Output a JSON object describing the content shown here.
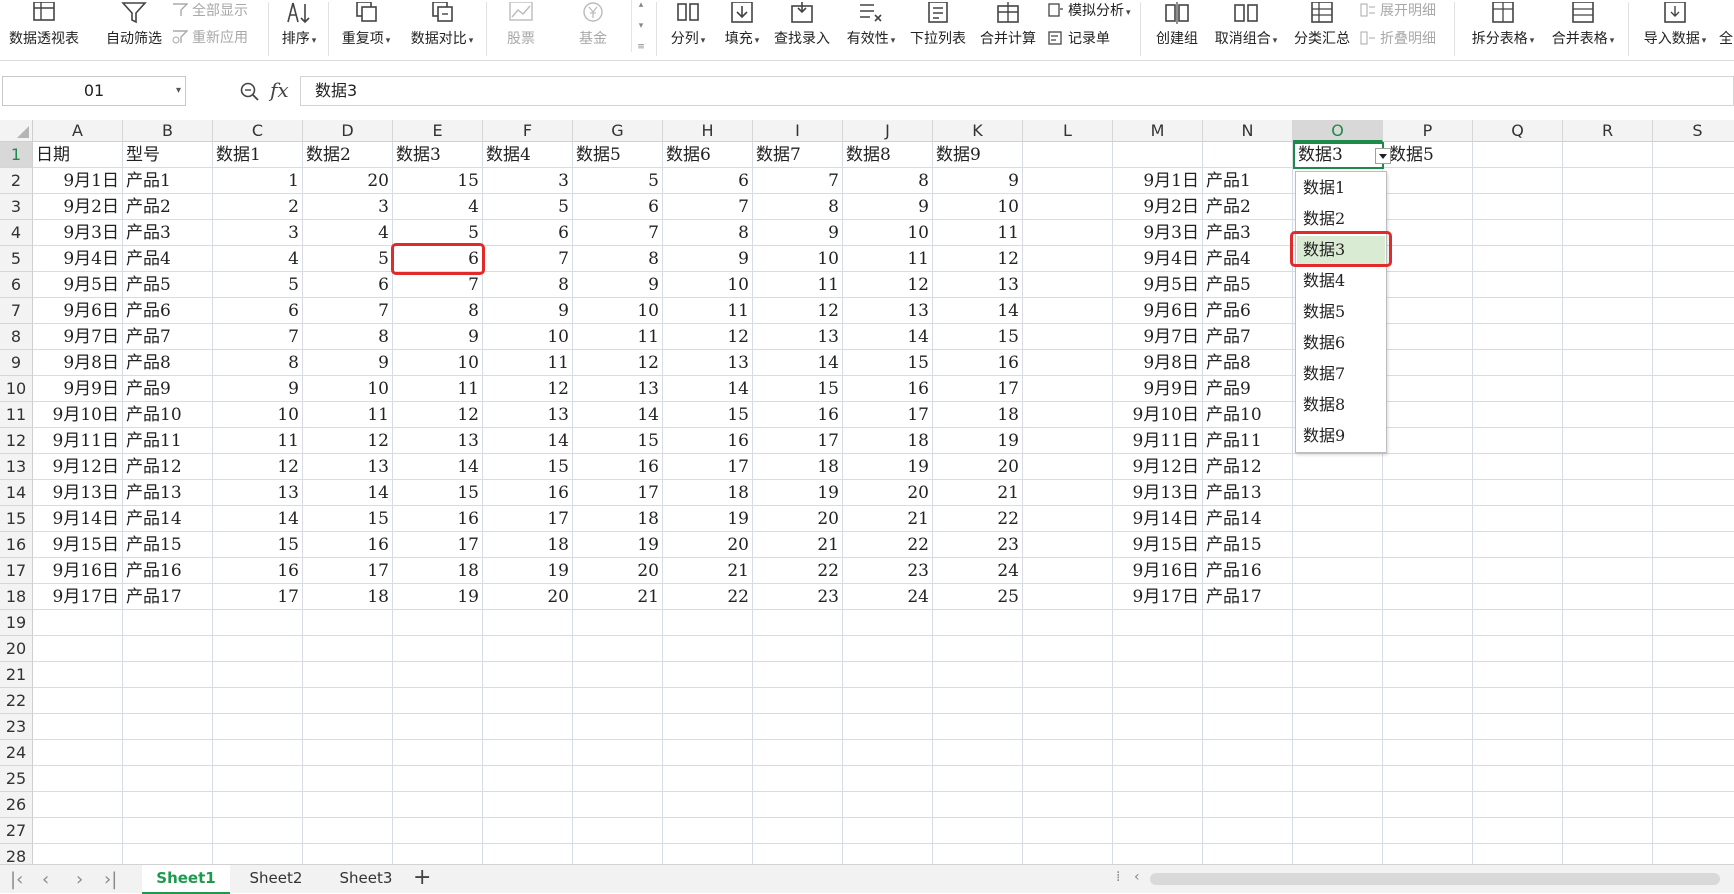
{
  "ribbon": {
    "pivot": "数据透视表",
    "autofilter": "自动筛选",
    "show_all": "全部显示",
    "reapply": "重新应用",
    "sort": "排序",
    "duplicates": "重复项",
    "compare": "数据对比",
    "stock": "股票",
    "fund": "基金",
    "split": "分列",
    "fill": "填充",
    "lookup": "查找录入",
    "validity": "有效性",
    "dropdown_list": "下拉列表",
    "consolidate": "合并计算",
    "what_if": "模拟分析",
    "record_sheet": "记录单",
    "create_group": "创建组",
    "ungroup": "取消组合",
    "subtotal": "分类汇总",
    "expand_detail": "展开明细",
    "collapse_detail": "折叠明细",
    "split_table": "拆分表格",
    "merge_table": "合并表格",
    "import_data": "导入数据",
    "more": "全"
  },
  "formula_bar": {
    "name_box": "01",
    "fx": "fx",
    "content": "数据3"
  },
  "grid": {
    "columns": [
      "A",
      "B",
      "C",
      "D",
      "E",
      "F",
      "G",
      "H",
      "I",
      "J",
      "K",
      "L",
      "M",
      "N",
      "O",
      "P",
      "Q",
      "R",
      "S"
    ],
    "selected_column": "O",
    "rows": [
      "1",
      "2",
      "3",
      "4",
      "5",
      "6",
      "7",
      "8",
      "9",
      "10",
      "11",
      "12",
      "13",
      "14",
      "15",
      "16",
      "17",
      "18",
      "19",
      "20",
      "21",
      "22",
      "23",
      "24",
      "25",
      "26",
      "27",
      "28"
    ],
    "selected_row": "1",
    "header": [
      "日期",
      "型号",
      "数据1",
      "数据2",
      "数据3",
      "数据4",
      "数据5",
      "数据6",
      "数据7",
      "数据8",
      "数据9"
    ],
    "dates": [
      "9月1日",
      "9月2日",
      "9月3日",
      "9月4日",
      "9月5日",
      "9月6日",
      "9月7日",
      "9月8日",
      "9月9日",
      "9月10日",
      "9月11日",
      "9月12日",
      "9月13日",
      "9月14日",
      "9月15日",
      "9月16日",
      "9月17日"
    ],
    "products": [
      "产品1",
      "产品2",
      "产品3",
      "产品4",
      "产品5",
      "产品6",
      "产品7",
      "产品8",
      "产品9",
      "产品10",
      "产品11",
      "产品12",
      "产品13",
      "产品14",
      "产品15",
      "产品16",
      "产品17"
    ],
    "table": [
      [
        1,
        20,
        15,
        3,
        5,
        6,
        7,
        8,
        9
      ],
      [
        2,
        3,
        4,
        5,
        6,
        7,
        8,
        9,
        10
      ],
      [
        3,
        4,
        5,
        6,
        7,
        8,
        9,
        10,
        11
      ],
      [
        4,
        5,
        6,
        7,
        8,
        9,
        10,
        11,
        12
      ],
      [
        5,
        6,
        7,
        8,
        9,
        10,
        11,
        12,
        13
      ],
      [
        6,
        7,
        8,
        9,
        10,
        11,
        12,
        13,
        14
      ],
      [
        7,
        8,
        9,
        10,
        11,
        12,
        13,
        14,
        15
      ],
      [
        8,
        9,
        10,
        11,
        12,
        13,
        14,
        15,
        16
      ],
      [
        9,
        10,
        11,
        12,
        13,
        14,
        15,
        16,
        17
      ],
      [
        10,
        11,
        12,
        13,
        14,
        15,
        16,
        17,
        18
      ],
      [
        11,
        12,
        13,
        14,
        15,
        16,
        17,
        18,
        19
      ],
      [
        12,
        13,
        14,
        15,
        16,
        17,
        18,
        19,
        20
      ],
      [
        13,
        14,
        15,
        16,
        17,
        18,
        19,
        20,
        21
      ],
      [
        14,
        15,
        16,
        17,
        18,
        19,
        20,
        21,
        22
      ],
      [
        15,
        16,
        17,
        18,
        19,
        20,
        21,
        22,
        23
      ],
      [
        16,
        17,
        18,
        19,
        20,
        21,
        22,
        23,
        24
      ],
      [
        17,
        18,
        19,
        20,
        21,
        22,
        23,
        24,
        25
      ]
    ],
    "o1_value": "数据3",
    "p1_value": "数据5"
  },
  "dropdown": {
    "options": [
      "数据1",
      "数据2",
      "数据3",
      "数据4",
      "数据5",
      "数据6",
      "数据7",
      "数据8",
      "数据9"
    ],
    "selected": "数据3"
  },
  "sheets": {
    "tabs": [
      "Sheet1",
      "Sheet2",
      "Sheet3"
    ],
    "active": "Sheet1",
    "add": "+"
  },
  "colors": {
    "accent_green": "#1e8a4a",
    "highlight_red": "#e12a2a",
    "dropdown_highlight": "#d9ebd3"
  }
}
